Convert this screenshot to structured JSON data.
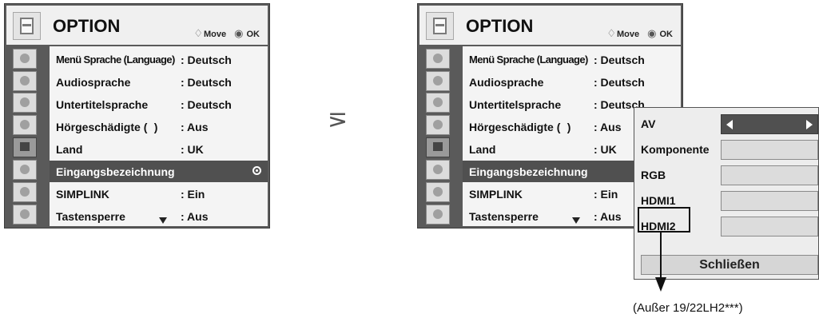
{
  "header": {
    "title": "OPTION",
    "move_label": "Move",
    "ok_label": "OK",
    "move_icon": "move-arrows-icon",
    "ok_icon": "ok-icon"
  },
  "left_menu": {
    "items": [
      {
        "label": "Menü Sprache (Language)",
        "value": ": Deutsch"
      },
      {
        "label": "Audiosprache",
        "value": ": Deutsch"
      },
      {
        "label": "Untertitelsprache",
        "value": ": Deutsch"
      },
      {
        "label": "Hörgeschädigte (   )",
        "value": ": Aus"
      },
      {
        "label": "Land",
        "value": ": UK"
      },
      {
        "label": "Eingangsbezeichnung",
        "value": ""
      },
      {
        "label": "SIMPLINK",
        "value": ": Ein"
      },
      {
        "label": "Tastensperre",
        "value": ": Aus"
      }
    ]
  },
  "right_menu": {
    "items": [
      {
        "label": "Menü Sprache (Language)",
        "value": ": Deutsch"
      },
      {
        "label": "Audiosprache",
        "value": ": Deutsch"
      },
      {
        "label": "Untertitelsprache",
        "value": ": Deutsch"
      },
      {
        "label": "Hörgeschädigte (   )",
        "value": ": Aus"
      },
      {
        "label": "Land",
        "value": ": UK"
      },
      {
        "label": "Eingangsbezeichnung",
        "value": ""
      },
      {
        "label": "SIMPLINK",
        "value": ": Ein"
      },
      {
        "label": "Tastensperre",
        "value": ": Aus"
      }
    ]
  },
  "popup": {
    "inputs": [
      "AV",
      "Komponente",
      "RGB",
      "HDMI1",
      "HDMI2"
    ],
    "close_label": "Schließen"
  },
  "step_arrow": "⋝",
  "footnote": "(Außer  19/22LH2***)",
  "colors": {
    "panel_frame": "#5a5a5a",
    "highlight": "#505050",
    "menu_bg": "#f4f4f4"
  }
}
